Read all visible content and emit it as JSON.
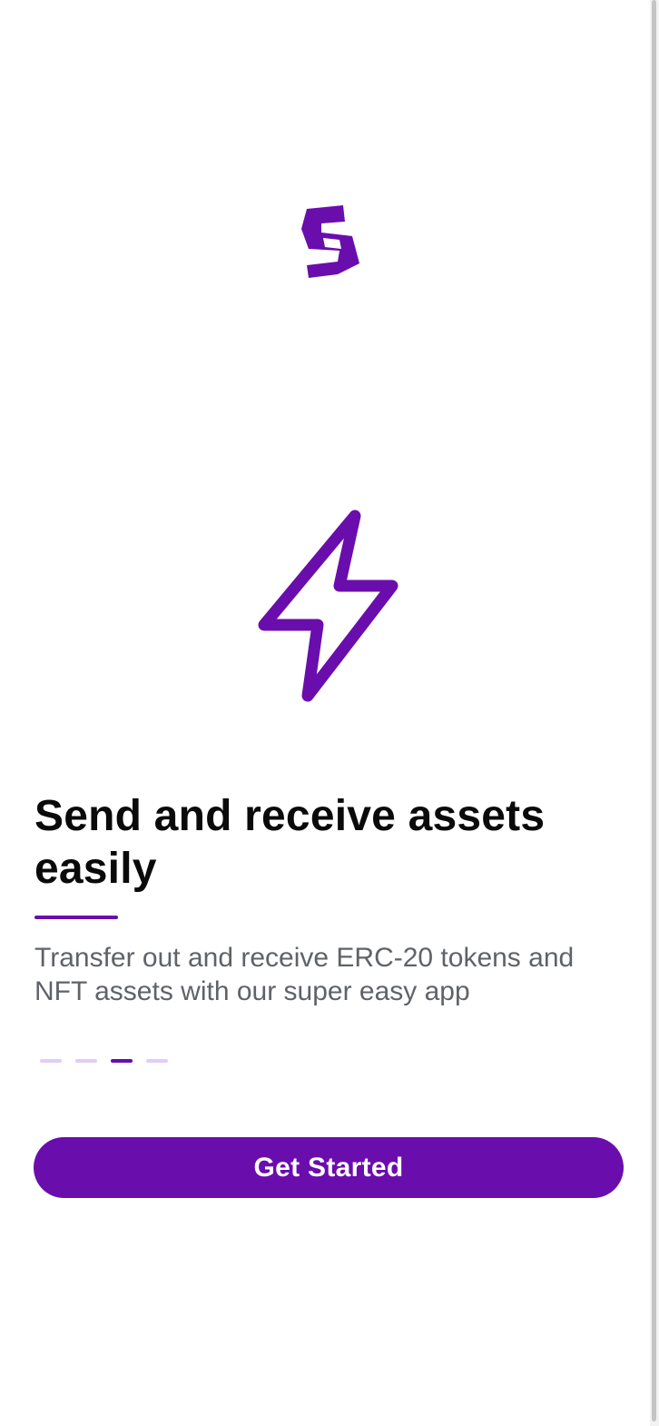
{
  "colors": {
    "accent": "#6a0dad",
    "accent_light": "#e2ccf6"
  },
  "logo": {
    "icon": "s-logo-icon"
  },
  "hero": {
    "icon": "lightning-bolt-icon"
  },
  "onboarding": {
    "title": "Send and receive assets easily",
    "subtitle": "Transfer out and receive ERC-20 tokens and NFT assets with our super easy app",
    "page_count": 4,
    "current_page": 3
  },
  "cta": {
    "label": "Get Started"
  }
}
